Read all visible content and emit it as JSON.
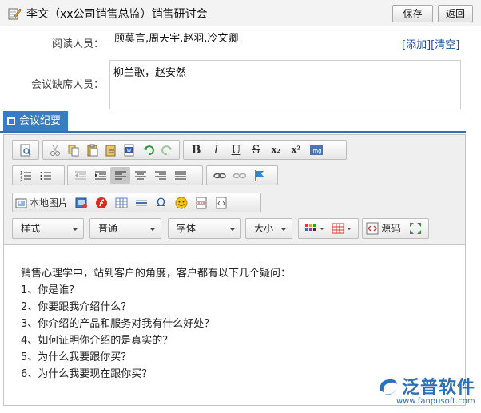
{
  "window": {
    "title": "李文（xx公司销售总监）销售研讨会",
    "save_label": "保存",
    "back_label": "返回"
  },
  "form": {
    "reader_label": "阅读人员：",
    "reader_value": "顾莫言,周天宇,赵羽,冷文卿",
    "add_label": "[添加]",
    "clear_label": "[清空]",
    "absent_label": "会议缺席人员：",
    "absent_value": "柳兰歌，赵安然"
  },
  "section": {
    "tab_label": "会议纪要"
  },
  "toolbar": {
    "local_image_label": "本地图片",
    "style_label": "样式",
    "format_label": "普通",
    "font_label": "字体",
    "size_label": "大小",
    "source_label": "源码",
    "bold": "B",
    "italic": "I",
    "underline": "U",
    "strike": "S",
    "subscript": "x₂",
    "superscript": "x²",
    "omega": "Ω"
  },
  "content": {
    "lines": [
      "销售心理学中，站到客户的角度，客户都有以下几个疑问：",
      "1、你是谁？",
      "2、你要跟我介绍什么？",
      "3、你介绍的产品和服务对我有什么好处？",
      "4、如何证明你介绍的是真实的？",
      "5、为什么我要跟你买？",
      "6、为什么我要现在跟你买？"
    ]
  },
  "watermark": {
    "brand": "泛普软件",
    "url": "www.fanpusoft.com"
  },
  "colors": {
    "accent": "#3a7cc1",
    "link": "#1b4f9c",
    "watermark": "#2d6fb8"
  }
}
